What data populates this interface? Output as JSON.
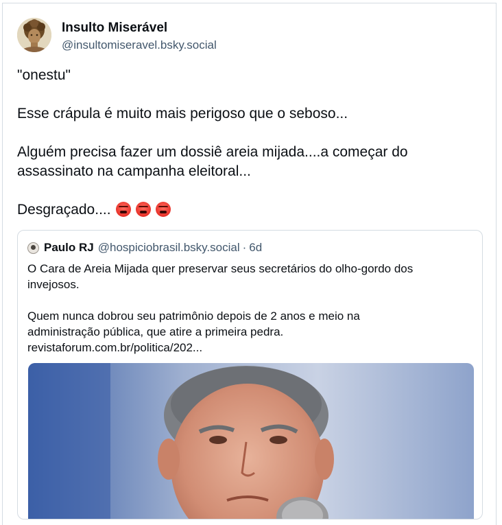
{
  "post": {
    "author_name": "Insulto Miserável",
    "author_handle": "@insultomiseravel.bsky.social",
    "lines": [
      "\"onestu\"",
      "Esse crápula é muito mais perigoso que o seboso...",
      "Alguém precisa fazer um dossiê areia mijada....a começar do",
      "assassinato na campanha eleitoral...",
      "Desgraçado...."
    ],
    "emoji_icon": "angry-face-emoji",
    "emoji_count": 3
  },
  "quote": {
    "author_name": "Paulo RJ",
    "author_handle": "@hospiciobrasil.bsky.social",
    "separator": "·",
    "time": "6d",
    "lines": [
      "O Cara de Areia Mijada quer preservar seus secretários do olho-gordo dos",
      "invejosos.",
      "Quem nunca dobrou seu patrimônio depois de 2 anos e meio na",
      "administração pública, que atire a primeira pedra."
    ],
    "link": "revistaforum.com.br/politica/202..."
  },
  "colors": {
    "border": "#d4dbe2",
    "text": "#0b0f14",
    "muted": "#42576c"
  }
}
